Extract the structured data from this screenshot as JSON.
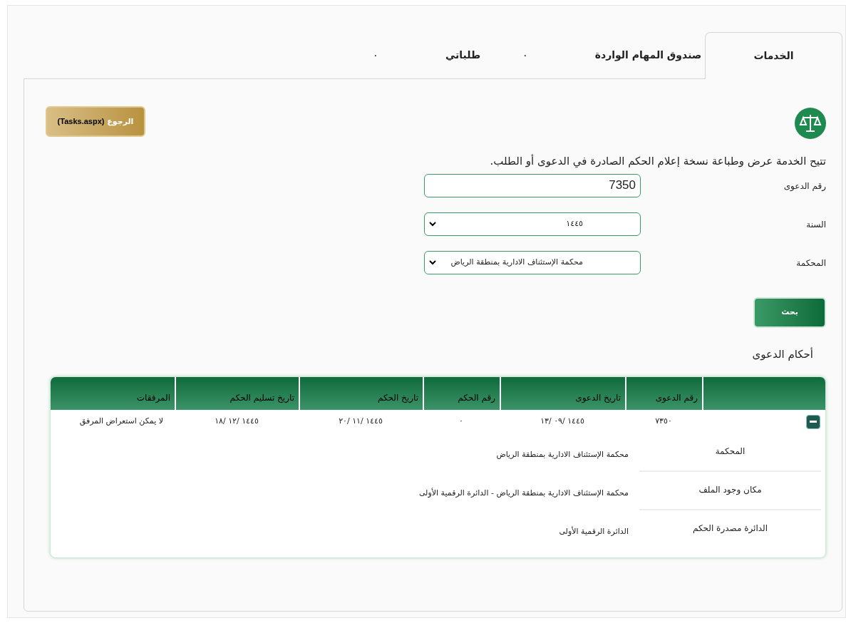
{
  "tabs": [
    {
      "label": "الخدمات",
      "selected": true
    },
    {
      "label": "صندوق المهام الواردة",
      "badge": "٠",
      "selected": false
    },
    {
      "label": "طلباتي",
      "badge": "٠",
      "selected": false
    }
  ],
  "back_button": {
    "label": "الرجوع",
    "target": "(Tasks.aspx)"
  },
  "description": "تتيح الخدمة عرض وطباعة نسخة إعلام الحكم الصادرة في الدعوى أو الطلب.",
  "form": [
    {
      "kind": "text",
      "label": "رقم الدعوى",
      "value": "7350"
    },
    {
      "kind": "select",
      "label": "السنة",
      "value": "١٤٤٥"
    },
    {
      "kind": "select",
      "label": "المحكمة",
      "value": "محكمة الإستئناف الادارية بمنطقة الرياض"
    }
  ],
  "search_button": "بحث",
  "section_title": "أحكام الدعوى",
  "table": {
    "columns": [
      "رقم الدعوى",
      "تاريخ الدعوى",
      "رقم الحكم",
      "تاريخ الحكم",
      "تاريخ تسليم الحكم",
      "المرفقات"
    ],
    "rows": [
      {
        "expanded": true,
        "cells": [
          "٧٣٥٠",
          "١٤٤٥ /٠٩ /١٣",
          "٠",
          "١٤٤٥ /١١ /٢٠",
          "١٤٤٥ /١٢ /١٨",
          "لا يمكن استعراض المرفق"
        ],
        "details": [
          {
            "label": "المحكمة",
            "value": "محكمة الإستئناف الادارية بمنطقة الرياض"
          },
          {
            "label": "مكان وجود الملف",
            "value": "محكمة الإستئناف الادارية بمنطقة الرياض - الدائرة الرقمية الأولى"
          },
          {
            "label": "الدائرة مصدرة الحكم",
            "value": "الدائرة الرقمية الأولى"
          }
        ]
      }
    ]
  }
}
